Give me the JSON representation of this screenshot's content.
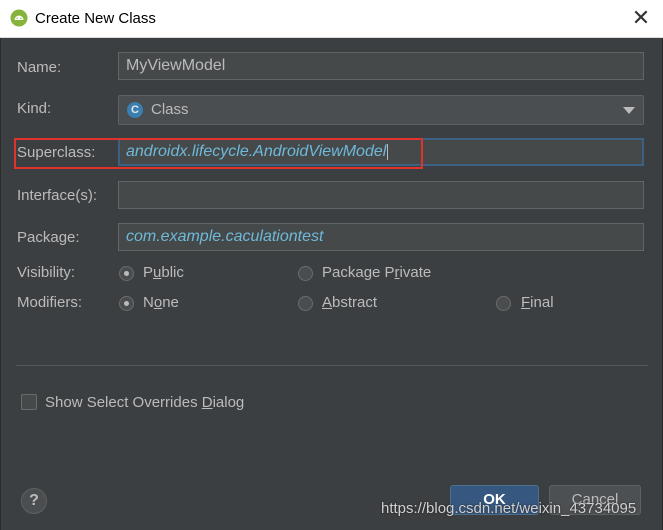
{
  "window": {
    "title": "Create New Class",
    "app_icon": "android-studio-icon",
    "close_glyph": "✕"
  },
  "form": {
    "name_label": "Name:",
    "name_value": "MyViewModel",
    "kind_label": "Kind:",
    "kind_value": "Class",
    "kind_icon_letter": "C",
    "superclass_label": "Superclass:",
    "superclass_value": "androidx.lifecycle.AndroidViewModel",
    "interfaces_label": "Interface(s):",
    "interfaces_value": "",
    "package_label": "Package:",
    "package_value": "com.example.caculationtest",
    "visibility_label": "Visibility:",
    "visibility_options": [
      {
        "pre": "P",
        "mn": "u",
        "post": "blic",
        "selected": true
      },
      {
        "pre": "Package P",
        "mn": "r",
        "post": "ivate",
        "selected": false
      }
    ],
    "modifiers_label": "Modifiers:",
    "modifier_options": [
      {
        "pre": "N",
        "mn": "o",
        "post": "ne",
        "selected": true
      },
      {
        "pre": "",
        "mn": "A",
        "post": "bstract",
        "selected": false
      },
      {
        "pre": "",
        "mn": "F",
        "post": "inal",
        "selected": false
      }
    ],
    "overrides_dialog": {
      "pre": "Show Select Overrides ",
      "mn": "D",
      "post": "ialog",
      "checked": false
    }
  },
  "buttons": {
    "help": "?",
    "ok": "OK",
    "cancel": "Cancel"
  },
  "watermark": "https://blog.csdn.net/weixin_43734095",
  "colors": {
    "dialog_bg": "#3c3f41",
    "field_bg": "#45494a",
    "italic_text": "#6fb9d9",
    "highlight_box": "#e0332d",
    "ok_button": "#365880"
  }
}
